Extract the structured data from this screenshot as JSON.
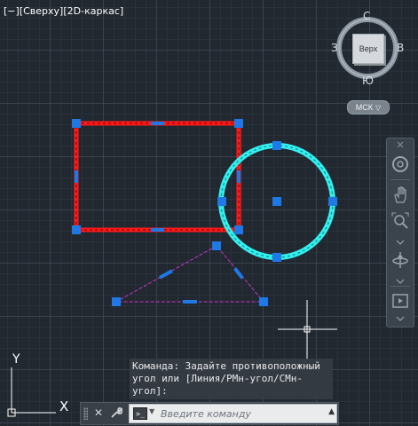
{
  "viewport": {
    "minimize_control": "[−]",
    "view_control": "[Сверху]",
    "style_control": "[2D-каркас]"
  },
  "viewcube": {
    "north": "С",
    "south": "Ю",
    "west": "З",
    "east": "В",
    "face_label": "Верх",
    "ucs_label": "МСК",
    "ucs_arrow": "▽"
  },
  "ucs_icon": {
    "y_label": "Y",
    "x_label": "X"
  },
  "navbar": {
    "items": [
      "steering-wheel-icon",
      "pan-icon",
      "zoom-extents-icon",
      "orbit-icon",
      "showmotion-icon"
    ]
  },
  "command": {
    "history": [
      "Команда: Задайте противоположный",
      "угол или [Линия/РМн-угол/СМн-",
      "угол]:"
    ],
    "close_glyph": "✕",
    "customize_glyph": "🔧",
    "prompt_glyph": ">_",
    "recent_glyph": "▼",
    "placeholder": "Введите команду",
    "scroll_glyph": "▲"
  },
  "colors": {
    "rectangle": "#ff1a1a",
    "circle": "#33f0f0",
    "triangle": "#cc33cc",
    "grip": "#1e78e6"
  }
}
